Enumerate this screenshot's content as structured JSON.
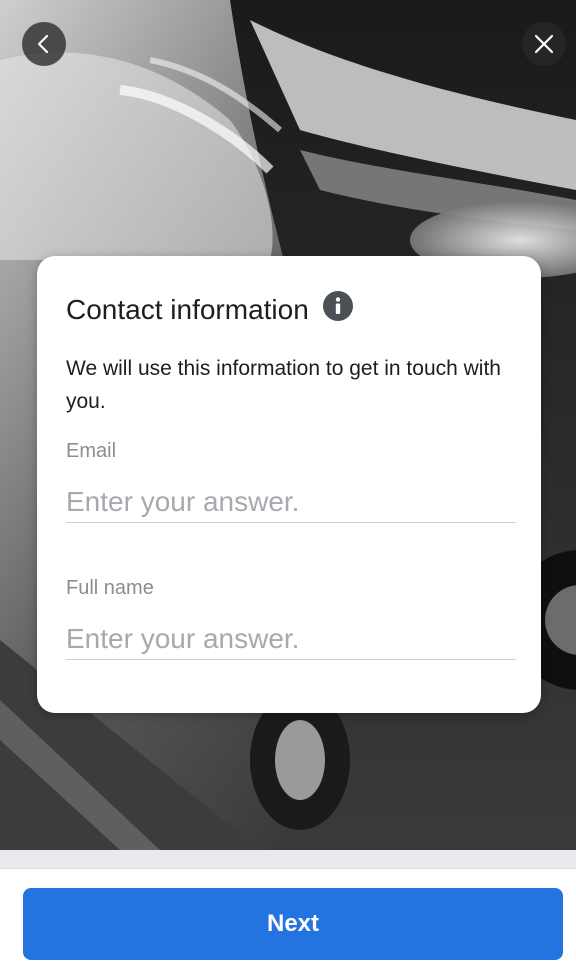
{
  "nav": {
    "back_icon": "chevron-left-icon",
    "close_icon": "close-icon"
  },
  "card": {
    "title": "Contact information",
    "info_icon": "info-icon",
    "description": "We will use this information to get in touch with you.",
    "fields": [
      {
        "label": "Email",
        "placeholder": "Enter your answer.",
        "value": ""
      },
      {
        "label": "Full name",
        "placeholder": "Enter your answer.",
        "value": ""
      }
    ]
  },
  "footer": {
    "next_label": "Next"
  },
  "colors": {
    "primary": "#2374e1",
    "text": "#1c1e21",
    "label": "#8a8d91",
    "placeholder": "#a6a9ae"
  }
}
